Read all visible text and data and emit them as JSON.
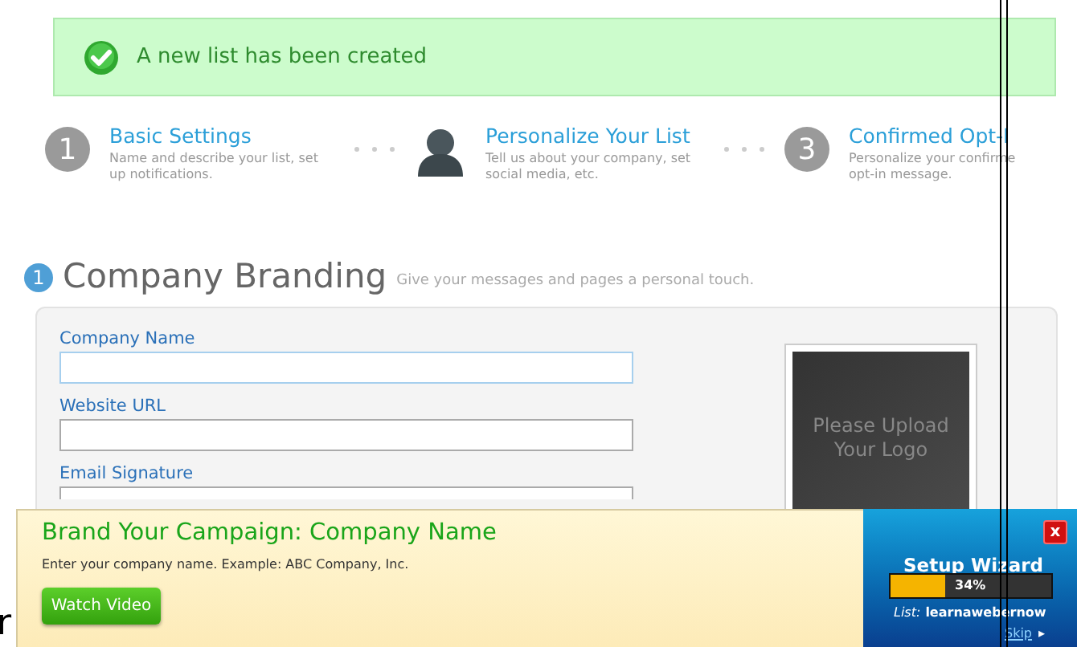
{
  "notice": {
    "text": "A new list has been created"
  },
  "steps": [
    {
      "number": "1",
      "title": "Basic Settings",
      "description": "Name and describe your list, set\nup notifications.",
      "selected": false
    },
    {
      "title": "Personalize Your List",
      "description": "Tell us about your company, set\nsocial media, etc.",
      "selected": true
    },
    {
      "number": "3",
      "title": "Confirmed Opt-I",
      "description": "Personalize your confirme\nopt-in message.",
      "selected": false
    }
  ],
  "section": {
    "number": "1",
    "title": "Company Branding",
    "subtitle": "Give your messages and pages a personal touch."
  },
  "fields": [
    {
      "label": "Company Name",
      "focused": true
    },
    {
      "label": "Website URL",
      "focused": false
    },
    {
      "label": "Email Signature",
      "focused": false
    }
  ],
  "logo_placeholder": "Please Upload Your Logo",
  "cut_text": "r",
  "banner": {
    "title": "Brand Your Campaign: Company Name",
    "hint": "Enter your company name. Example: ABC Company, Inc.",
    "button": "Watch Video"
  },
  "wizard": {
    "close": "x",
    "title": "Setup Wizard",
    "level": 0.34,
    "reading": "34%",
    "list_label": "List:",
    "list_name": "learnawebernow",
    "skip": "Skip",
    "skip_arrow": "▸"
  }
}
